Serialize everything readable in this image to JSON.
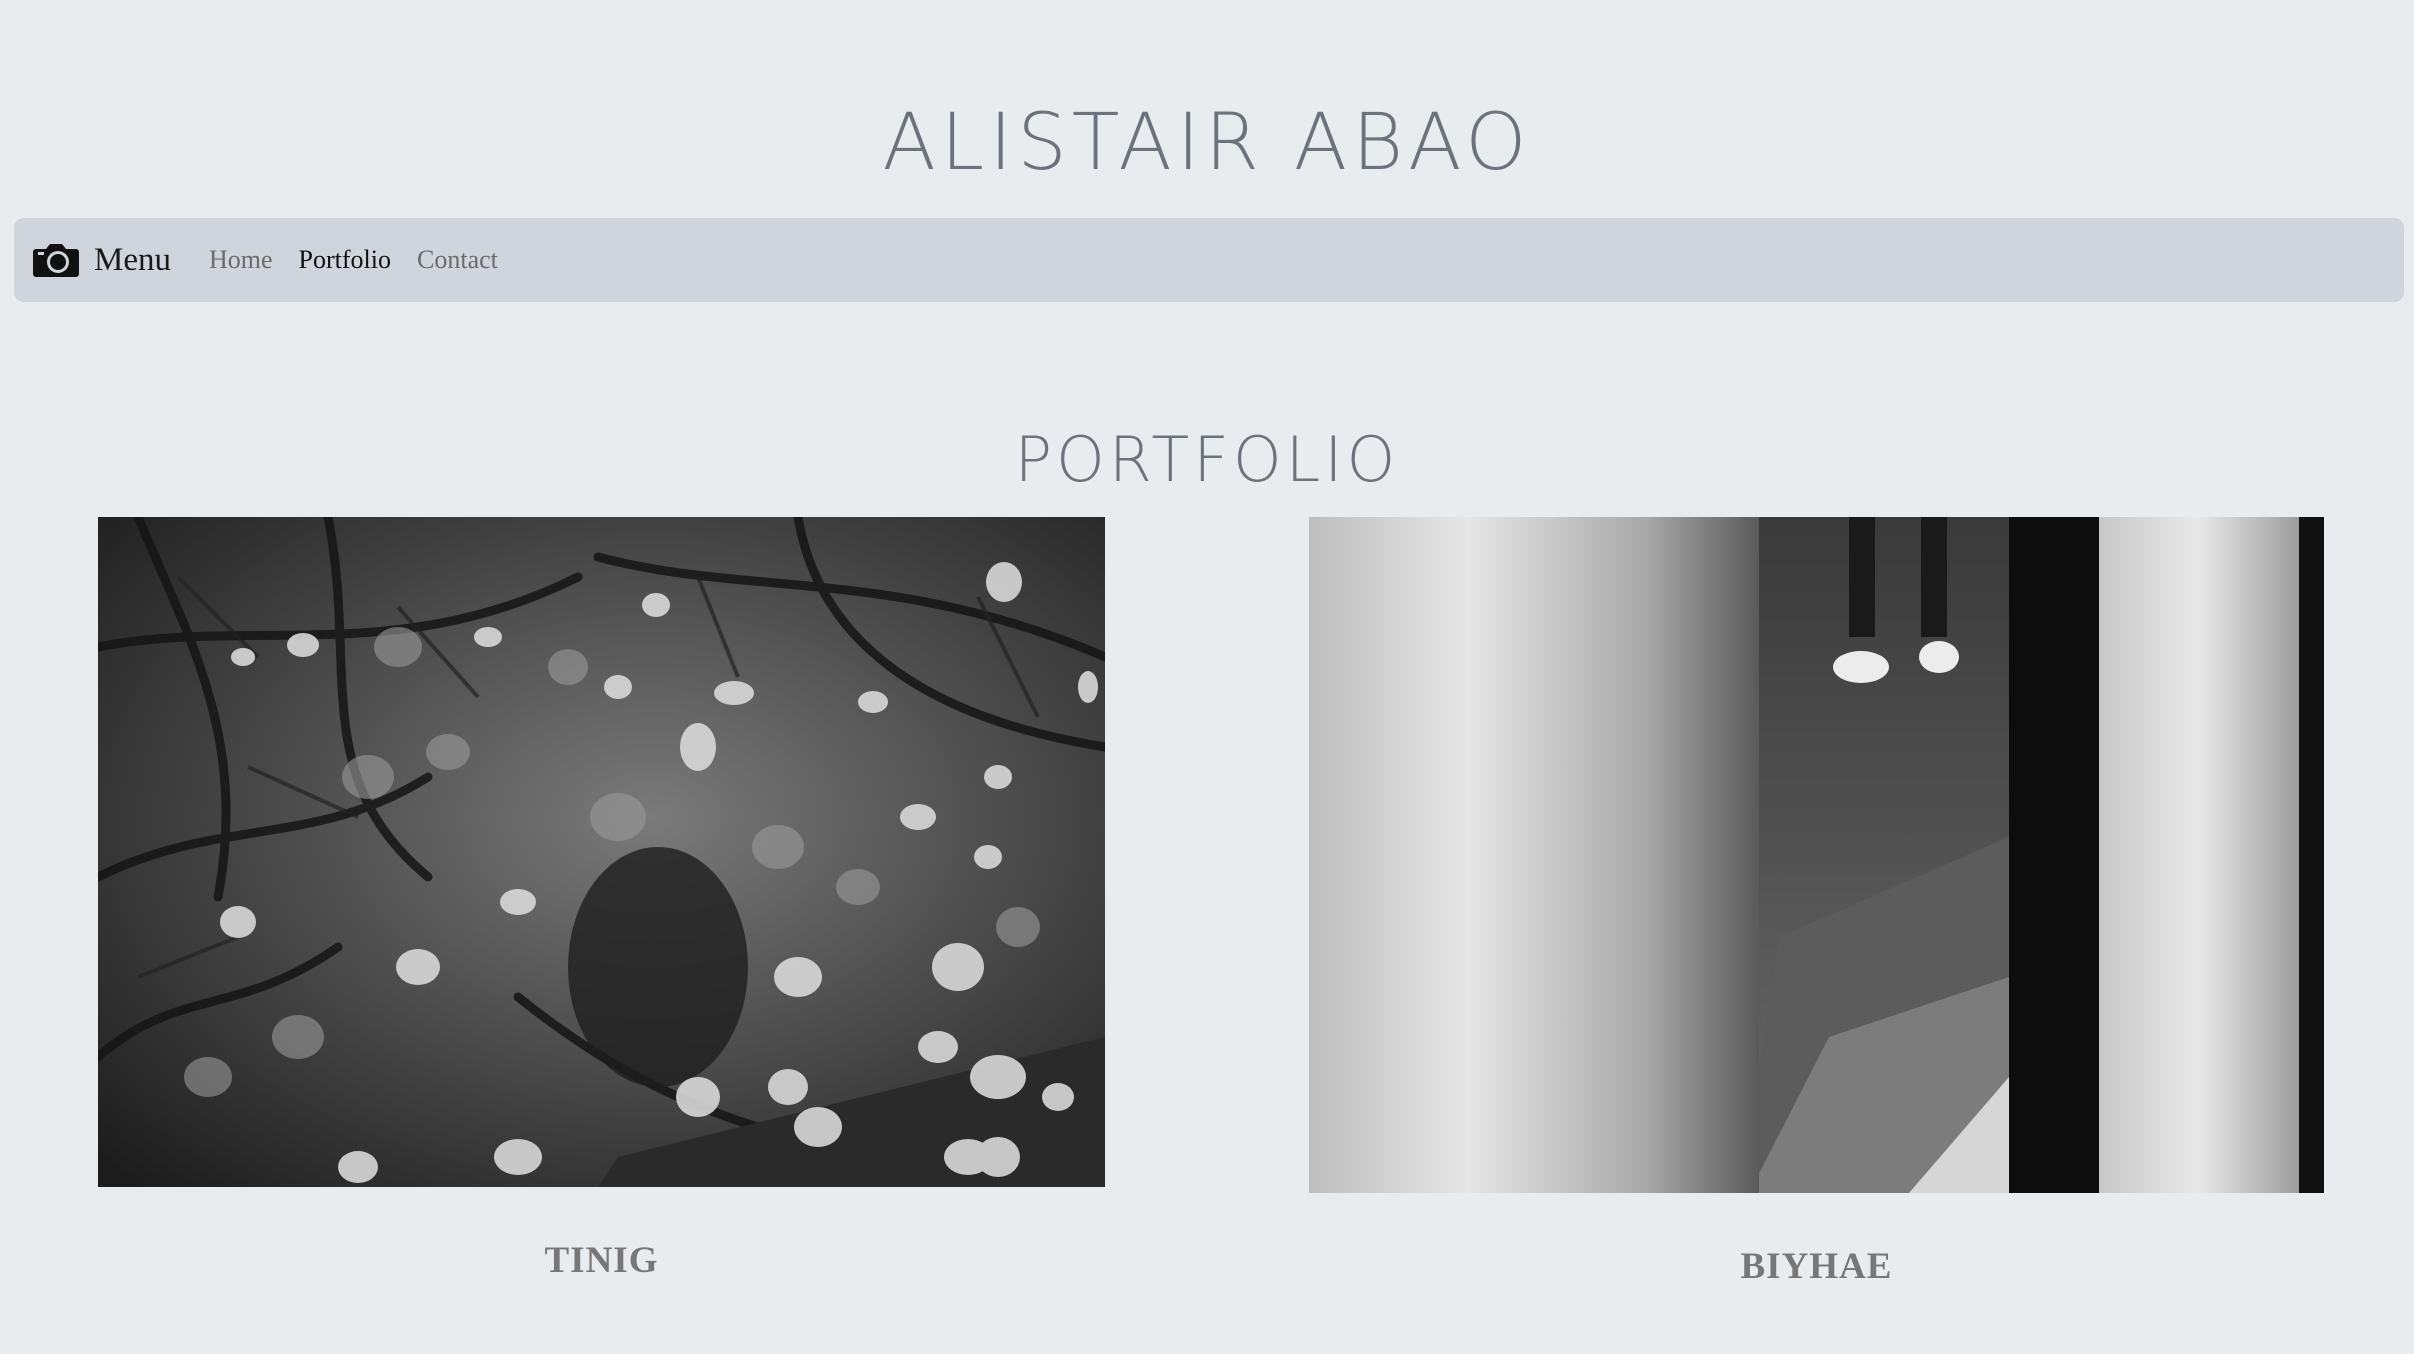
{
  "site": {
    "title": "ALISTAIR ABAO"
  },
  "navbar": {
    "brand_icon": "camera-icon",
    "brand_label": "Menu",
    "links": [
      {
        "label": "Home",
        "active": false
      },
      {
        "label": "Portfolio",
        "active": true
      },
      {
        "label": "Contact",
        "active": false
      }
    ]
  },
  "page": {
    "section_title": "PORTFOLIO"
  },
  "portfolio": {
    "items": [
      {
        "caption": "TINIG"
      },
      {
        "caption": "BIYHAE"
      }
    ]
  },
  "colors": {
    "background": "#e9ecef",
    "navbar": "#d0d4dc",
    "title_text": "#6c737d",
    "caption_text": "#777777"
  }
}
